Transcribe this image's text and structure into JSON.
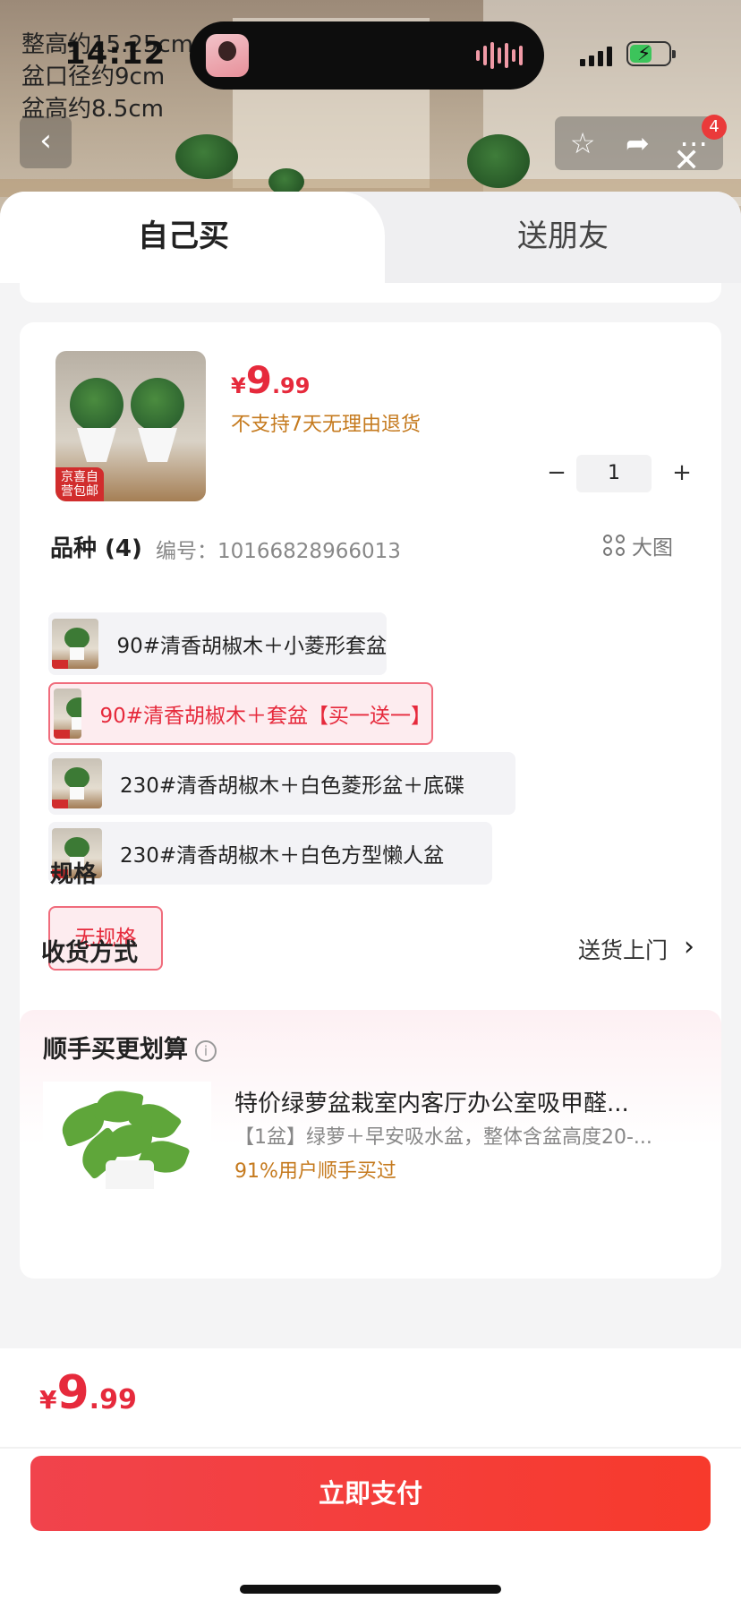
{
  "status_bar": {
    "time": "14:12"
  },
  "product_image_overlay": {
    "lines": [
      "整高约15.25cm",
      "盆口径约9cm",
      "盆高约8.5cm"
    ]
  },
  "nav": {
    "badge_count": "4"
  },
  "tabs": [
    {
      "label": "自己买",
      "active": true
    },
    {
      "label": "送朋友",
      "active": false
    }
  ],
  "product": {
    "currency": "¥",
    "price_int": "9",
    "price_dec": ".99",
    "return_policy": "不支持7天无理由退货",
    "thumb_tag": "京喜自营包邮",
    "quantity": "1",
    "stepper_minus": "−",
    "stepper_plus": "+"
  },
  "variety": {
    "title": "品种 (4)",
    "code_label": "编号：10166828966013",
    "big_image_label": "大图",
    "options": [
      {
        "label": "90#清香胡椒木＋小菱形套盆",
        "selected": false
      },
      {
        "label": "90#清香胡椒木＋套盆【买一送一】",
        "selected": true
      },
      {
        "label": "230#清香胡椒木＋白色菱形盆＋底碟",
        "selected": false
      },
      {
        "label": "230#清香胡椒木＋白色方型懒人盆",
        "selected": false
      }
    ]
  },
  "spec": {
    "title": "规格",
    "options": [
      {
        "label": "无规格",
        "selected": true
      }
    ]
  },
  "delivery": {
    "label": "收货方式",
    "value": "送货上门"
  },
  "upsell": {
    "title": "顺手买更划算",
    "info_icon": "i",
    "item": {
      "name": "特价绿萝盆栽室内客厅办公室吸甲醛...",
      "desc": "【1盆】绿萝＋早安吸水盆，整体含盆高度20-...",
      "rate": "91%用户顺手买过"
    }
  },
  "footer": {
    "currency": "¥",
    "price_int": "9",
    "price_dec": ".99",
    "pay_label": "立即支付"
  },
  "colors": {
    "accent": "#e62a3c",
    "pay_button": "#f1434c",
    "warning_text": "#c57a1e"
  }
}
